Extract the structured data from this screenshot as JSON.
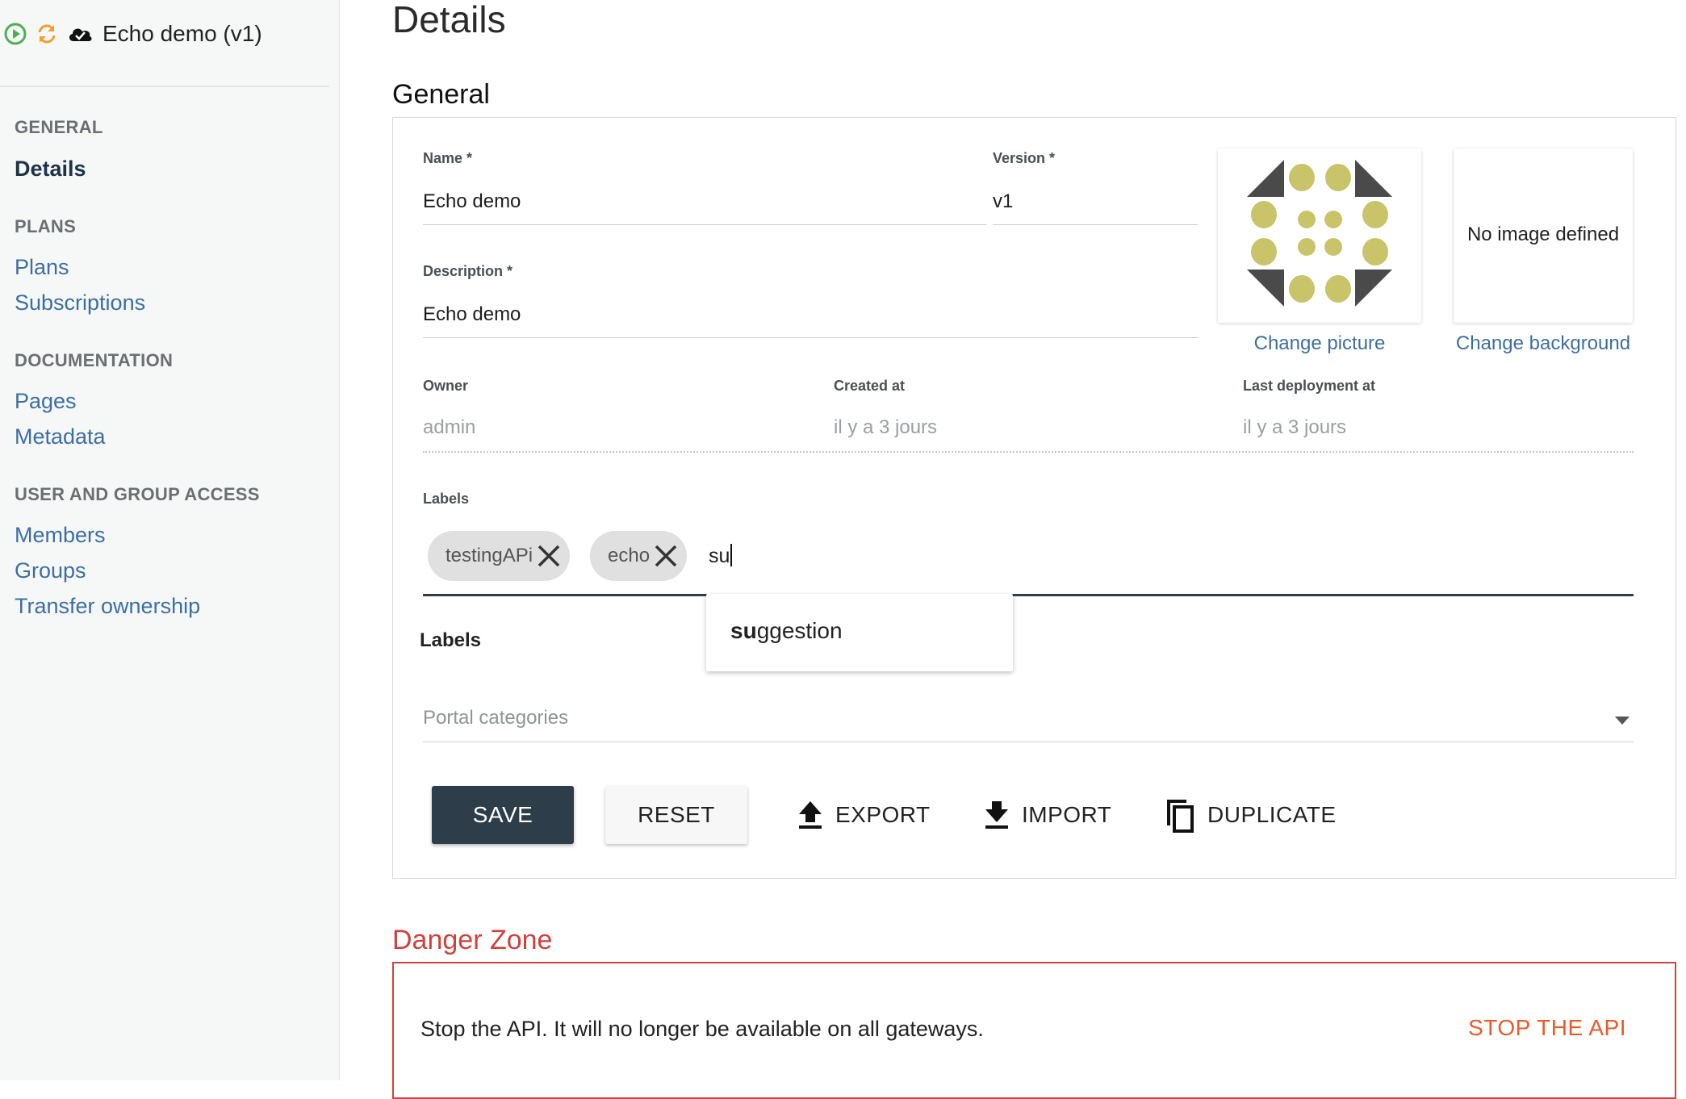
{
  "api": {
    "title": "Echo demo (v1)",
    "status_icons": [
      "play-circle-icon",
      "sync-icon",
      "cloud-check-icon"
    ]
  },
  "sidebar": {
    "sections": [
      {
        "title": "GENERAL",
        "items": [
          {
            "label": "Details",
            "active": true
          }
        ]
      },
      {
        "title": "PLANS",
        "items": [
          {
            "label": "Plans"
          },
          {
            "label": "Subscriptions"
          }
        ]
      },
      {
        "title": "DOCUMENTATION",
        "items": [
          {
            "label": "Pages"
          },
          {
            "label": "Metadata"
          }
        ]
      },
      {
        "title": "USER AND GROUP ACCESS",
        "items": [
          {
            "label": "Members"
          },
          {
            "label": "Groups"
          },
          {
            "label": "Transfer ownership"
          }
        ]
      }
    ]
  },
  "page": {
    "title": "Details",
    "general_title": "General"
  },
  "form": {
    "name_label": "Name *",
    "name_value": "Echo demo",
    "version_label": "Version *",
    "version_value": "v1",
    "description_label": "Description *",
    "description_value": "Echo demo",
    "owner_label": "Owner",
    "owner_value": "admin",
    "created_label": "Created at",
    "created_value": "il y a 3 jours",
    "deploy_label": "Last deployment at",
    "deploy_value": "il y a 3 jours",
    "labels_label": "Labels",
    "labels_chips": [
      "testingAPi",
      "echo"
    ],
    "labels_input": "su",
    "suggestion_match": "su",
    "suggestion_rest": "ggestion",
    "labels_section_title": "Labels",
    "categories_placeholder": "Portal categories"
  },
  "images": {
    "change_picture": "Change picture",
    "change_background": "Change background",
    "no_image": "No image defined"
  },
  "actions": {
    "save": "SAVE",
    "reset": "RESET",
    "export": "EXPORT",
    "import": "IMPORT",
    "duplicate": "DUPLICATE"
  },
  "danger": {
    "title": "Danger Zone",
    "stop_text": "Stop the API. It will no longer be available on all gateways.",
    "stop_button": "STOP THE API"
  },
  "colors": {
    "accent": "#2d3e4a",
    "link": "#3d6ea3",
    "danger": "#d0413e",
    "danger_action": "#ea5a2c",
    "avatar_dots": "#c9c36a",
    "avatar_triangles": "#4a4a4a",
    "status_green": "#4caf50",
    "status_orange": "#f0a030"
  }
}
